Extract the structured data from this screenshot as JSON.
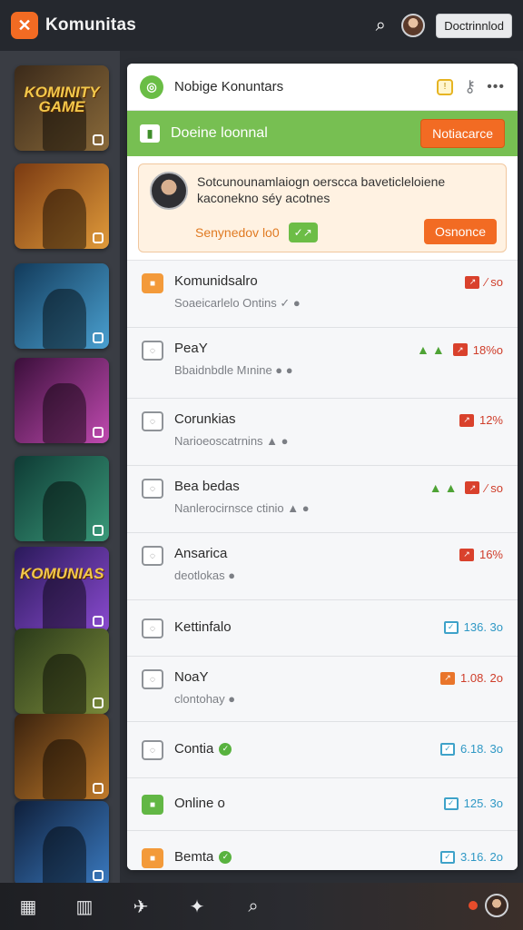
{
  "topbar": {
    "logo_icon": "logo-icon",
    "title": "Komunitas",
    "subtitle": "",
    "button_label": "Doctrinnlod"
  },
  "rail": {
    "thumbs": [
      {
        "title": "KOMINITY GAME",
        "colors": [
          "#3b2a1a",
          "#8a6a3a"
        ]
      },
      {
        "title": "",
        "colors": [
          "#7a3a12",
          "#e09a3a"
        ]
      },
      {
        "title": "",
        "colors": [
          "#123a5a",
          "#4aa0d0"
        ]
      },
      {
        "title": "",
        "colors": [
          "#3a0f3a",
          "#c04ab0"
        ]
      },
      {
        "title": "",
        "colors": [
          "#0e3a34",
          "#3a9a7a"
        ]
      },
      {
        "title": "KOMUNIAS",
        "colors": [
          "#2a1a5a",
          "#8a4ad0"
        ]
      },
      {
        "title": "",
        "colors": [
          "#2a3a1a",
          "#7a8a3a"
        ]
      },
      {
        "title": "",
        "colors": [
          "#3a220e",
          "#c07a2a"
        ]
      },
      {
        "title": "",
        "colors": [
          "#0f1f3a",
          "#3a7ac0"
        ]
      }
    ]
  },
  "panel": {
    "header_title": "Nobige Konuntars",
    "banner_title": "Doeine loonnal",
    "banner_button": "Notiacarce",
    "notice": {
      "text": "Sotcunounamlaiogn oerscca baveticleloiene kaconekno séy acotnes",
      "meta": "Senynedov lo0",
      "chip": "✓↗",
      "button": "Osnonce"
    },
    "rows": [
      {
        "title": "Komunidsalro",
        "sub": "Soaeicarlelo Ontins ✓ ●",
        "icon": "orange",
        "right_value": "∕ so",
        "right_kind": "red",
        "arrows": false,
        "check": false
      },
      {
        "title": "PeaY",
        "sub": "Bbaidnbdle Mınine ● ●",
        "icon": "outline",
        "right_value": "18%o",
        "right_kind": "red",
        "arrows": true,
        "check": false
      },
      {
        "title": "Corunkias",
        "sub": "Narioeoscatrnins ▲ ●",
        "icon": "outline",
        "right_value": "12%",
        "right_kind": "red",
        "arrows": false,
        "check": false
      },
      {
        "title": "Bea bedas",
        "sub": "Nanlerocirnsce ctinio ▲ ●",
        "icon": "outline",
        "right_value": "∕ so",
        "right_kind": "red",
        "arrows": true,
        "check": false
      },
      {
        "title": "Ansarica",
        "sub": "deotlokas ●",
        "icon": "outline",
        "right_value": "16%",
        "right_kind": "red",
        "arrows": false,
        "check": false
      },
      {
        "title": "Kettinfalo",
        "sub": "",
        "icon": "outline",
        "right_value": "136. 3o",
        "right_kind": "blue",
        "arrows": false,
        "check": false
      },
      {
        "title": "NoaY",
        "sub": "clontohay ●",
        "icon": "outline",
        "right_value": "1.08. 2o",
        "right_kind": "orange",
        "arrows": false,
        "check": false
      },
      {
        "title": "Contia",
        "sub": "",
        "icon": "outline",
        "right_value": "6.18. 3o",
        "right_kind": "blue",
        "arrows": false,
        "check": true
      },
      {
        "title": "Online o",
        "sub": "",
        "icon": "green",
        "right_value": "125. 3o",
        "right_kind": "blue",
        "arrows": false,
        "check": false
      },
      {
        "title": "Bemta",
        "sub": "",
        "icon": "orange",
        "right_value": "3.16. 2o",
        "right_kind": "blue",
        "arrows": false,
        "check": true
      }
    ]
  },
  "bottombar": {
    "icons": [
      "windows-icon",
      "book-icon",
      "twitter-icon",
      "star-icon",
      "search-icon"
    ]
  }
}
